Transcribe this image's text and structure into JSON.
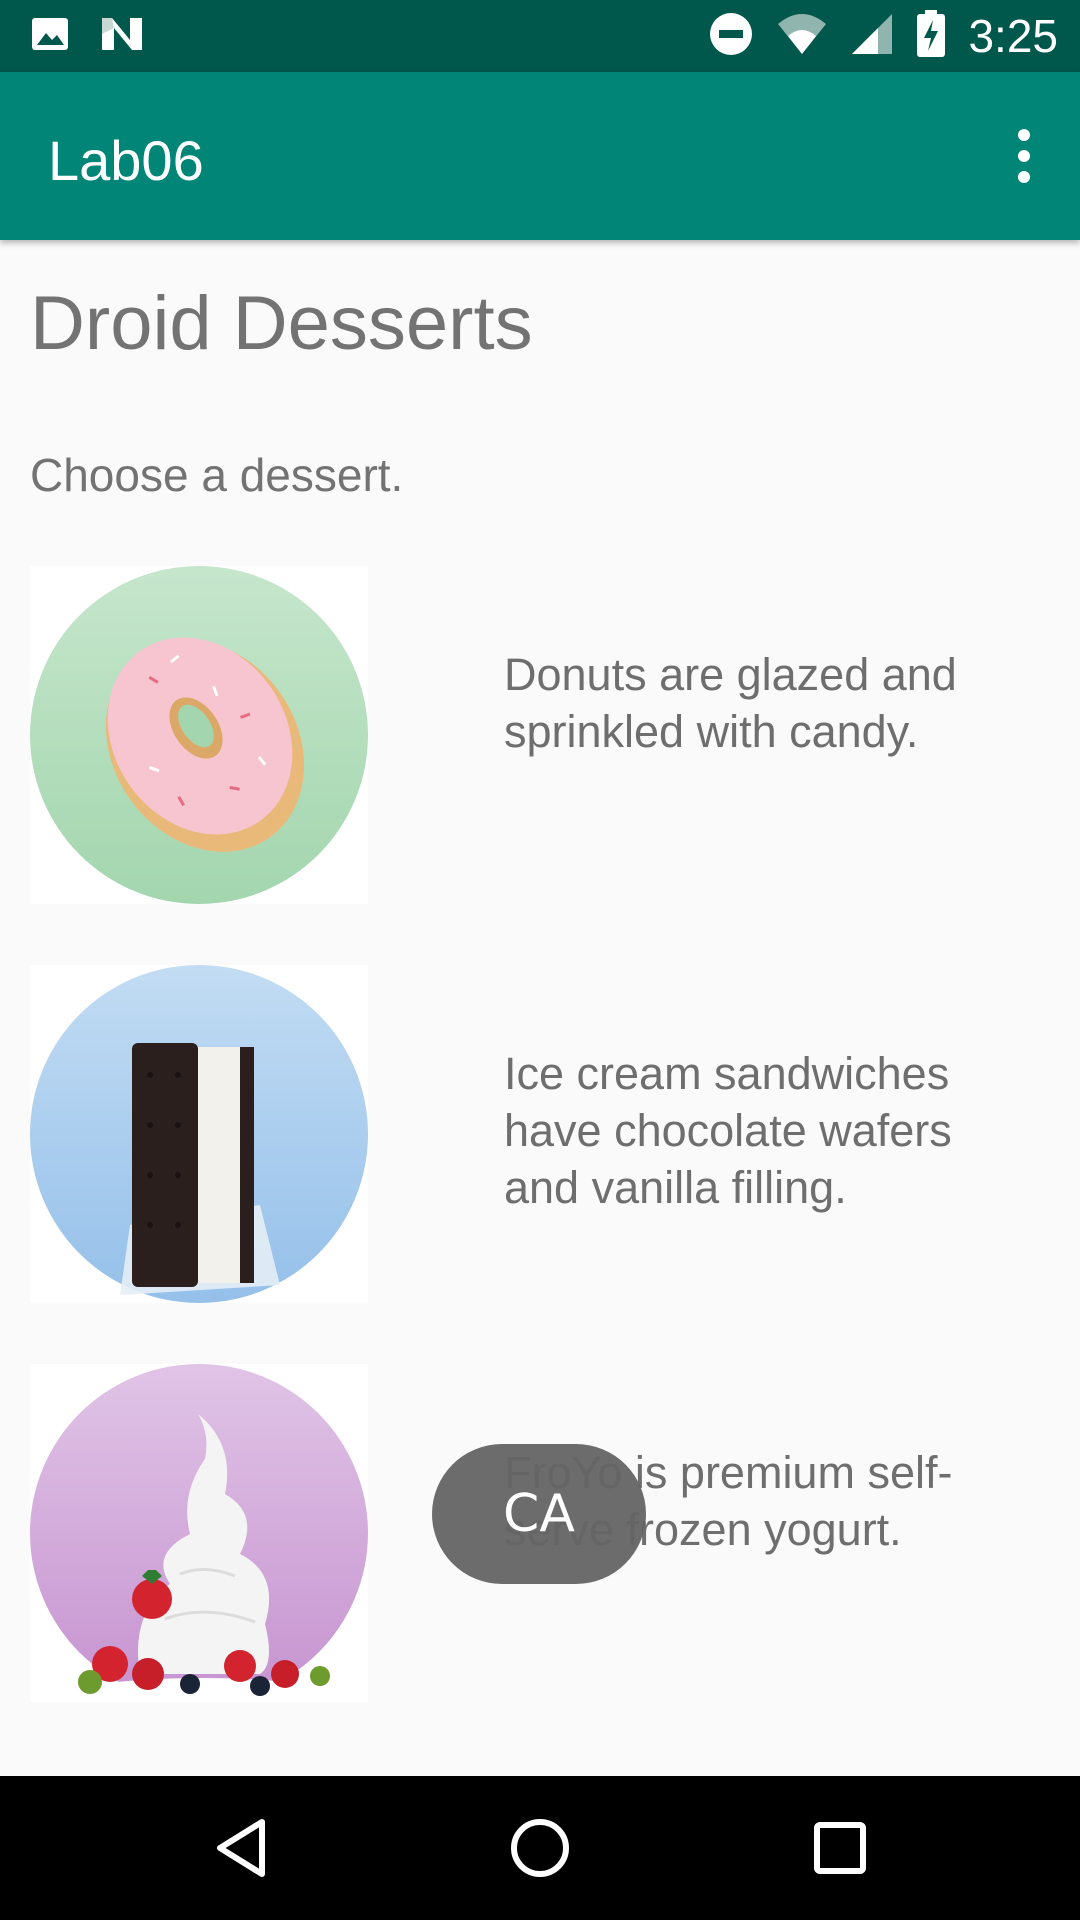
{
  "status_bar": {
    "time": "3:25",
    "icons": [
      "image-icon",
      "n-icon",
      "do-not-disturb-icon",
      "wifi-icon",
      "signal-icon",
      "battery-charging-icon"
    ]
  },
  "app_bar": {
    "title": "Lab06",
    "menu_icon": "overflow-menu-icon"
  },
  "content": {
    "title": "Droid Desserts",
    "subtitle": "Choose a dessert.",
    "desserts": [
      {
        "image": "donut",
        "description": "Donuts are glazed and sprinkled with candy."
      },
      {
        "image": "ice-cream-sandwich",
        "description": "Ice cream sandwiches have chocolate wafers and vanilla filling."
      },
      {
        "image": "froyo",
        "description": "FroYo is premium self-serve frozen yogurt."
      }
    ]
  },
  "toast": {
    "text": "CA"
  },
  "nav_bar": {
    "buttons": [
      "back-icon",
      "home-icon",
      "recents-icon"
    ]
  },
  "colors": {
    "status_bar": "#00574b",
    "app_bar": "#008577",
    "background": "#fafafa",
    "text": "#737373"
  }
}
